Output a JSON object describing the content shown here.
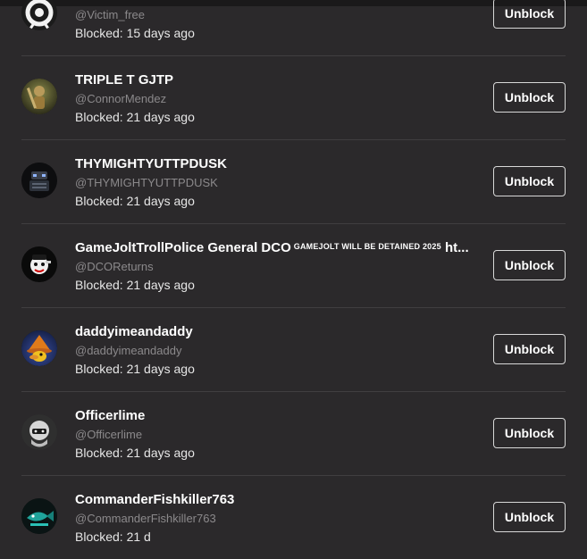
{
  "blocked_users": [
    {
      "name": "",
      "tag": "",
      "handle": "@Victim_free",
      "blocked": "Blocked: 15 days ago",
      "action": "Unblock",
      "avatar_icon": "victim-avatar-icon"
    },
    {
      "name": "TRIPLE T GJTP",
      "tag": "",
      "handle": "@ConnorMendez",
      "blocked": "Blocked: 21 days ago",
      "action": "Unblock",
      "avatar_icon": "character-avatar-icon"
    },
    {
      "name": "THYMIGHTYUTTPDUSK",
      "tag": "",
      "handle": "@THYMIGHTYUTTPDUSK",
      "blocked": "Blocked: 21 days ago",
      "action": "Unblock",
      "avatar_icon": "robot-avatar-icon"
    },
    {
      "name": "GameJoltTrollPolice General DCO",
      "tag": "GAMEJOLT WILL BE DETAINED 2025",
      "name_suffix": "ht...",
      "handle": "@DCOReturns",
      "blocked": "Blocked: 21 days ago",
      "action": "Unblock",
      "avatar_icon": "police-avatar-icon"
    },
    {
      "name": "daddyimeandaddy",
      "tag": "",
      "handle": "@daddyimeandaddy",
      "blocked": "Blocked: 21 days ago",
      "action": "Unblock",
      "avatar_icon": "wizard-avatar-icon"
    },
    {
      "name": "Officerlime",
      "tag": "",
      "handle": "@Officerlime",
      "blocked": "Blocked: 21 days ago",
      "action": "Unblock",
      "avatar_icon": "helmet-avatar-icon"
    },
    {
      "name": "CommanderFishkiller763",
      "tag": "",
      "handle": "@CommanderFishkiller763",
      "blocked": "Blocked: 21 d",
      "action": "Unblock",
      "avatar_icon": "fish-avatar-icon"
    }
  ]
}
